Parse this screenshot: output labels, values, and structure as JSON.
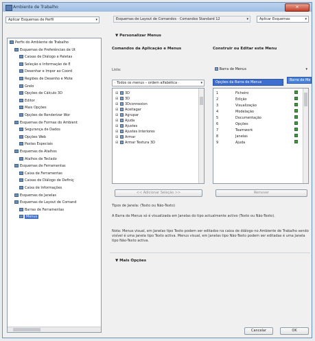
{
  "window": {
    "title": "Ambiente de Trabalho",
    "close_label": "✕"
  },
  "left": {
    "scheme_combo": "Aplicar Esquemas de Perfil",
    "tree_items": [
      {
        "label": "Perfis do Ambiente de Trabalho",
        "indent": 0
      },
      {
        "label": "Esquemas de Preferências de Ut",
        "indent": 1
      },
      {
        "label": "Caixas de Diálogo e Paletas",
        "indent": 2
      },
      {
        "label": "Seleção e Informação de E",
        "indent": 2
      },
      {
        "label": "Desenhar e Impor ao Coord",
        "indent": 2
      },
      {
        "label": "Regiões de Desenho e Mote",
        "indent": 2
      },
      {
        "label": "Grelo",
        "indent": 2
      },
      {
        "label": "Opções de Cálculo 3D",
        "indent": 2
      },
      {
        "label": "Editor",
        "indent": 2
      },
      {
        "label": "Mais Opções",
        "indent": 2
      },
      {
        "label": "Opções de Renderizar Wor",
        "indent": 2
      },
      {
        "label": "Esquemas de Formas do Ambient",
        "indent": 1
      },
      {
        "label": "Segurança de Dados",
        "indent": 2
      },
      {
        "label": "Opções Web",
        "indent": 2
      },
      {
        "label": "Pastas Especiais",
        "indent": 2
      },
      {
        "label": "Esquemas de Atalhos",
        "indent": 1
      },
      {
        "label": "Atalhos de Teclado",
        "indent": 2
      },
      {
        "label": "Esquemas de Ferramentas",
        "indent": 1
      },
      {
        "label": "Caixa de Ferramentas",
        "indent": 2
      },
      {
        "label": "Caixas de Diálogo de Definiç",
        "indent": 2
      },
      {
        "label": "Caixa de Informações",
        "indent": 2
      },
      {
        "label": "Esquemas de Janelas",
        "indent": 1
      },
      {
        "label": "Esquemas de Layout de Comand",
        "indent": 1
      },
      {
        "label": "Barras de Ferramentas",
        "indent": 2
      },
      {
        "label": "Menus",
        "indent": 2,
        "selected": true
      }
    ]
  },
  "right": {
    "layout_combo": "Esquemas de Layout de Comandos · Comandos Standard 12",
    "apply_combo": "Aplicar Esquemas",
    "section1": "▼ Personalizar Menus",
    "col_left_head": "Comandos da Aplicação e Menus",
    "col_right_head": "Construir ou Editar este Menu",
    "list_label": "Lista:",
    "list_filter": "· Todos os menus – ordem alfabética ·",
    "menu_combo": "Barra de Menus",
    "selected_menu": "Opções da Barra de Menus",
    "drag_item": "Barra de Me",
    "commands": [
      {
        "label": "3D"
      },
      {
        "label": "3D"
      },
      {
        "label": "3Dconnexion"
      },
      {
        "label": "Aceitagar"
      },
      {
        "label": "Agrupar"
      },
      {
        "label": "Ajuda"
      },
      {
        "label": "Ajustes"
      },
      {
        "label": "Ajustes Interiores"
      },
      {
        "label": "Armar"
      },
      {
        "label": "Armar Textura 3D"
      }
    ],
    "menu_items": [
      {
        "num": "1",
        "label": "Ficheiro"
      },
      {
        "num": "2",
        "label": "Edição"
      },
      {
        "num": "3",
        "label": "Visualização"
      },
      {
        "num": "4",
        "label": "Modelação"
      },
      {
        "num": "5",
        "label": "Documentação"
      },
      {
        "num": "6",
        "label": "Opções"
      },
      {
        "num": "7",
        "label": "Teamwork"
      },
      {
        "num": "8",
        "label": "Janelas"
      },
      {
        "num": "9",
        "label": "Ajuda"
      }
    ],
    "add_btn": "<< Adicionar Seleção >>",
    "remove_btn": "Remover",
    "window_type": "Tipos de Janela: (Texto ou Não-Texto)",
    "info1": "A Barra de Menus só é visualizada em Janelas do tipo actualmente activo (Texto ou Não-Texto).",
    "info2": "Nota: Menus visual, em Janelas tipo Texto podem ser editados na caixa de diálogo no Ambiente de Trabalho sendo visível é uma janela tipo Texto activa. Menus visual, em Janelas tipo Não-Texto podem ser editadas é uma Janela tipo Não-Texto activa.",
    "section2": "▼ Mais Opções"
  },
  "footer": {
    "cancel": "Cancelar",
    "ok": "OK"
  }
}
